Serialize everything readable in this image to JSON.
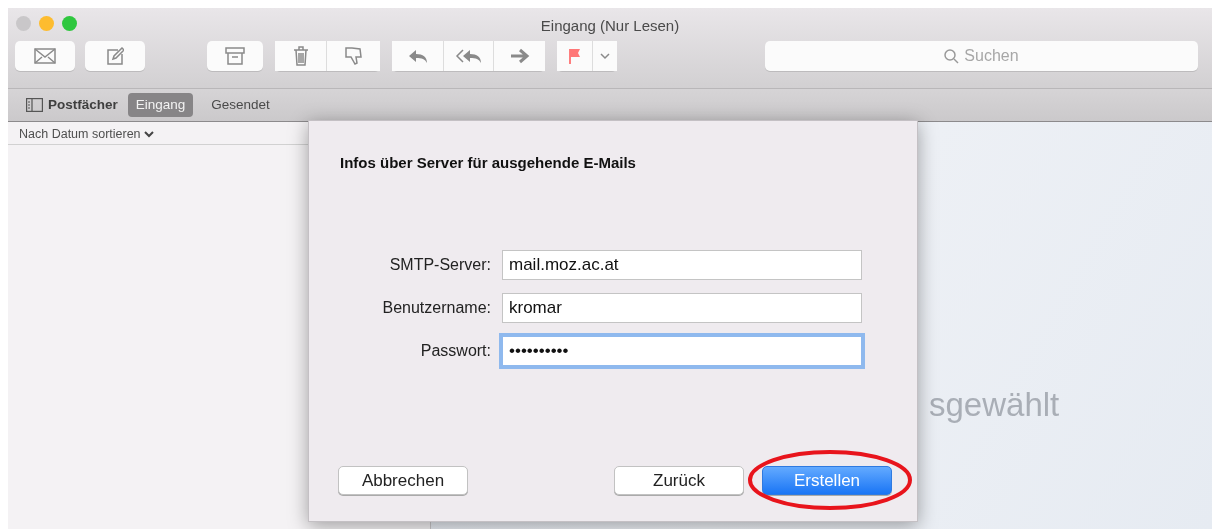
{
  "window": {
    "title": "Eingang (Nur Lesen)",
    "traffic_lights": [
      {
        "color": "#c9c7c9"
      },
      {
        "color": "#fdbc2f"
      },
      {
        "color": "#2fc73f"
      }
    ]
  },
  "search": {
    "placeholder": "Suchen"
  },
  "favorites": {
    "mailboxes_label": "Postfächer",
    "tabs": [
      {
        "label": "Eingang",
        "selected": true
      },
      {
        "label": "Gesendet",
        "selected": false
      }
    ]
  },
  "message_list": {
    "sort_label": "Nach Datum sortieren"
  },
  "preview": {
    "text": "sgewählt"
  },
  "dialog": {
    "title": "Infos über Server für ausgehende E-Mails",
    "fields": [
      {
        "label": "SMTP-Server:",
        "value": "mail.moz.ac.at",
        "focused": false
      },
      {
        "label": "Benutzername:",
        "value": "kromar",
        "focused": false
      },
      {
        "label": "Passwort:",
        "value": "••••••••••",
        "focused": true
      }
    ],
    "buttons": [
      {
        "label": "Abbrechen",
        "kind": "plain",
        "highlighted": false
      },
      {
        "label": "Zurück",
        "kind": "plain",
        "highlighted": false
      },
      {
        "label": "Erstellen",
        "kind": "default",
        "highlighted": true
      }
    ]
  }
}
